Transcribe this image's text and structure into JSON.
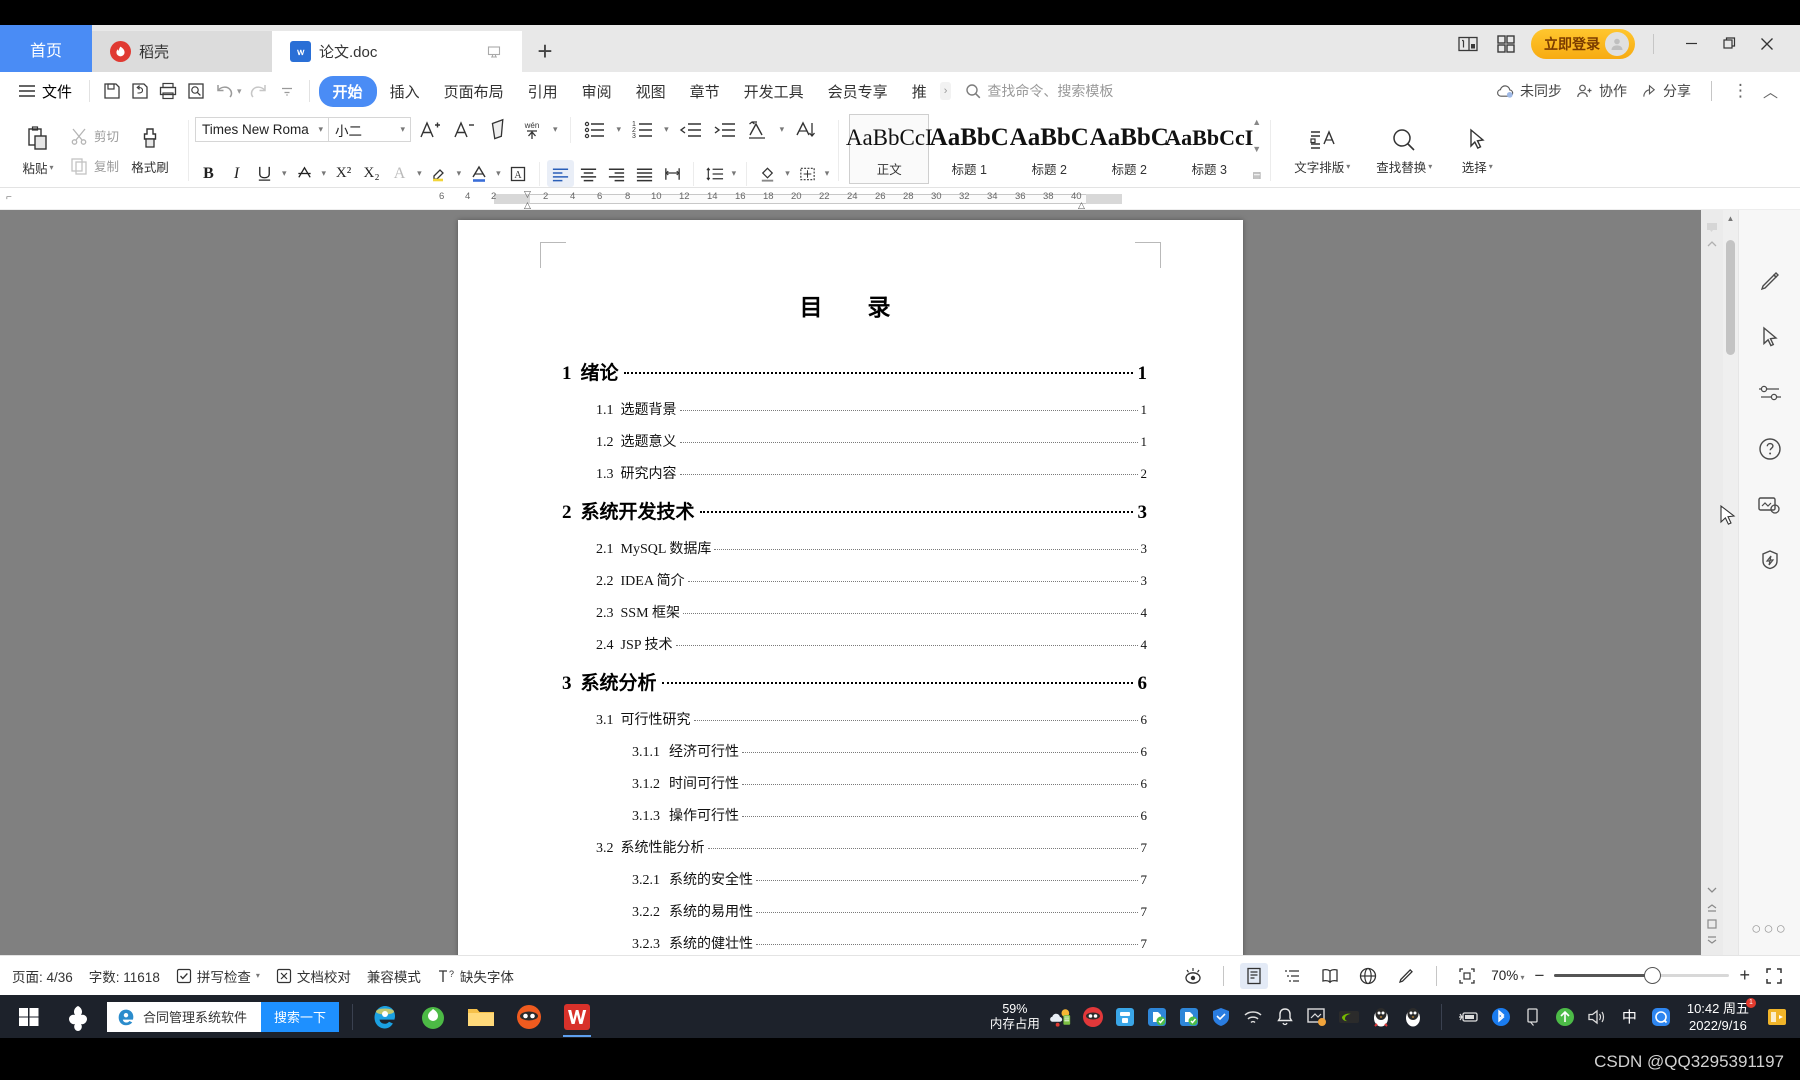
{
  "window": {
    "tabs": [
      {
        "label": "首页",
        "icon": "home-tab",
        "state": "home"
      },
      {
        "label": "稻壳",
        "icon": "daoke-icon",
        "state": "inactive"
      },
      {
        "label": "论文.doc",
        "icon": "wps-word-icon",
        "state": "active"
      }
    ],
    "new_tab_label": "+",
    "login_label": "立即登录",
    "minimize": "—",
    "maximize": "❐",
    "close": "✕"
  },
  "menu": {
    "file_label": "文件",
    "quick_icons": [
      "save-icon",
      "save-as-icon",
      "print-icon",
      "print-preview-icon",
      "undo-icon",
      "redo-icon",
      "customize-icon"
    ],
    "items": [
      {
        "label": "开始",
        "active": true
      },
      {
        "label": "插入",
        "active": false
      },
      {
        "label": "页面布局",
        "active": false
      },
      {
        "label": "引用",
        "active": false
      },
      {
        "label": "审阅",
        "active": false
      },
      {
        "label": "视图",
        "active": false
      },
      {
        "label": "章节",
        "active": false
      },
      {
        "label": "开发工具",
        "active": false
      },
      {
        "label": "会员专享",
        "active": false
      },
      {
        "label": "推",
        "active": false
      }
    ],
    "more_chevron": "›",
    "search_placeholder": "查找命令、搜索模板",
    "right_items": [
      {
        "label": "未同步",
        "icon": "cloud-sync-icon"
      },
      {
        "label": "协作",
        "icon": "collaborate-icon"
      },
      {
        "label": "分享",
        "icon": "share-icon"
      }
    ],
    "overflow": "⋮",
    "collapse": "︿"
  },
  "ribbon": {
    "paste_label": "粘贴",
    "cut_label": "剪切",
    "copy_label": "复制",
    "format_painter_label": "格式刷",
    "font_name": "Times New Roma",
    "font_size": "小二",
    "bold": "B",
    "italic": "I",
    "underline": "U",
    "strikethrough": "A",
    "superscript": "X²",
    "subscript": "X₂",
    "text_effect": "A",
    "highlight": "highlighter-icon",
    "font_color": "A",
    "char_border": "A",
    "grow_font": "A⁺",
    "shrink_font": "A⁻",
    "clear_format": "eraser-icon",
    "pinyin_guide": "wén",
    "bullets": "bullet-list-icon",
    "numbering": "numbered-list-icon",
    "decrease_indent": "decrease-indent-icon",
    "increase_indent": "increase-indent-icon",
    "paragraph_layout": "paragraph-layout-icon",
    "sort": "sort-icon",
    "show_marks": "show-marks-icon",
    "line_spacing": "line-spacing-icon",
    "shading": "shading-icon",
    "borders": "borders-icon",
    "align_left": "align-left-icon",
    "align_center": "align-center-icon",
    "align_right": "align-right-icon",
    "align_justify": "align-justify-icon",
    "distribute": "distribute-icon",
    "styles": [
      {
        "preview": "AaBbCcI",
        "label": "正文",
        "selected": true,
        "bold": false
      },
      {
        "preview": "AaBbC",
        "label": "标题 1",
        "selected": false,
        "bold": true
      },
      {
        "preview": "AaBbC",
        "label": "标题 2",
        "selected": false,
        "bold": true
      },
      {
        "preview": "AaBbC",
        "label": "标题 2",
        "selected": false,
        "bold": true
      },
      {
        "preview": "AaBbCcI",
        "label": "标题 3",
        "selected": false,
        "bold": true
      }
    ],
    "text_layout_label": "文字排版",
    "find_replace_label": "查找替换",
    "select_label": "选择"
  },
  "ruler": {
    "marks": [
      "6",
      "4",
      "2",
      "2",
      "4",
      "6",
      "8",
      "10",
      "12",
      "14",
      "16",
      "18",
      "20",
      "22",
      "24",
      "26",
      "28",
      "30",
      "32",
      "34",
      "36",
      "38",
      "40"
    ]
  },
  "document": {
    "title": "目　录",
    "toc": [
      {
        "level": 1,
        "num": "1",
        "title": "绪论",
        "page": "1"
      },
      {
        "level": 2,
        "num": "1.1",
        "title": "选题背景",
        "page": "1"
      },
      {
        "level": 2,
        "num": "1.2",
        "title": "选题意义",
        "page": "1"
      },
      {
        "level": 2,
        "num": "1.3",
        "title": "研究内容",
        "page": "2"
      },
      {
        "level": 1,
        "num": "2",
        "title": "系统开发技术",
        "page": "3"
      },
      {
        "level": 2,
        "num": "2.1",
        "title": "MySQL 数据库",
        "page": "3"
      },
      {
        "level": 2,
        "num": "2.2",
        "title": "IDEA 简介",
        "page": "3"
      },
      {
        "level": 2,
        "num": "2.3",
        "title": "SSM 框架",
        "page": "4"
      },
      {
        "level": 2,
        "num": "2.4",
        "title": "JSP 技术",
        "page": "4"
      },
      {
        "level": 1,
        "num": "3",
        "title": "系统分析",
        "page": "6"
      },
      {
        "level": 2,
        "num": "3.1",
        "title": "可行性研究",
        "page": "6"
      },
      {
        "level": 3,
        "num": "3.1.1",
        "title": "经济可行性",
        "page": "6"
      },
      {
        "level": 3,
        "num": "3.1.2",
        "title": "时间可行性",
        "page": "6"
      },
      {
        "level": 3,
        "num": "3.1.3",
        "title": "操作可行性",
        "page": "6"
      },
      {
        "level": 2,
        "num": "3.2",
        "title": "系统性能分析",
        "page": "7"
      },
      {
        "level": 3,
        "num": "3.2.1",
        "title": "系统的安全性",
        "page": "7"
      },
      {
        "level": 3,
        "num": "3.2.2",
        "title": "系统的易用性",
        "page": "7"
      },
      {
        "level": 3,
        "num": "3.2.3",
        "title": "系统的健壮性",
        "page": "7"
      }
    ]
  },
  "sidebar": {
    "icons": [
      "pen-tool-icon",
      "cursor-select-icon",
      "settings-sliders-icon",
      "help-icon",
      "image-resource-icon",
      "ai-badge-icon"
    ],
    "more": "○○○"
  },
  "statusbar": {
    "page_label": "页面: 4/36",
    "words_label": "字数: 11618",
    "spellcheck_label": "拼写检查",
    "proofread_label": "文档校对",
    "compat_label": "兼容模式",
    "missing_font_label": "缺失字体",
    "eye_icon": "eye-protect-icon",
    "views": [
      {
        "icon": "page-view-icon",
        "selected": true
      },
      {
        "icon": "outline-view-icon",
        "selected": false
      },
      {
        "icon": "reading-view-icon",
        "selected": false
      },
      {
        "icon": "web-view-icon",
        "selected": false
      },
      {
        "icon": "edit-pen-icon",
        "selected": false
      }
    ],
    "fit_icon": "fit-page-icon",
    "zoom_value": "70%",
    "zoom_minus": "−",
    "zoom_plus": "+",
    "fullscreen_icon": "fullscreen-icon"
  },
  "taskbar": {
    "start_icon": "windows-start-icon",
    "apps": [
      {
        "icon": "sogou-icon",
        "name": "sogou-input"
      },
      {
        "icon": "ie-icon",
        "name": "internet-explorer"
      },
      {
        "icon": "browser-360-icon",
        "name": "360-browser"
      },
      {
        "icon": "folder-icon",
        "name": "file-explorer"
      },
      {
        "icon": "ninja-icon",
        "name": "ninja-app"
      },
      {
        "icon": "wps-icon",
        "name": "wps-office"
      }
    ],
    "search_text": "合同管理系统软件",
    "search_button": "搜索一下",
    "memory_percent": "59%",
    "memory_label": "内存占用",
    "tray_icons": [
      "weather-icon",
      "redmonster-icon",
      "qqpcmgr-icon",
      "sync1-icon",
      "sync2-icon",
      "tencent-shield-icon",
      "wifi-icon",
      "bell-icon",
      "nvidia-icon",
      "screenshot-icon",
      "qq-penguin-icon",
      "qq-penguin2-icon",
      "battery-icon",
      "bluetooth-icon",
      "usb-icon",
      "update-icon",
      "volume-icon",
      "ime-cn-icon",
      "qq-browser-icon"
    ],
    "ime_label": "中",
    "time": "10:42 周五",
    "date": "2022/9/16",
    "notification_count": "1"
  },
  "watermark": "CSDN @QQ3295391197"
}
